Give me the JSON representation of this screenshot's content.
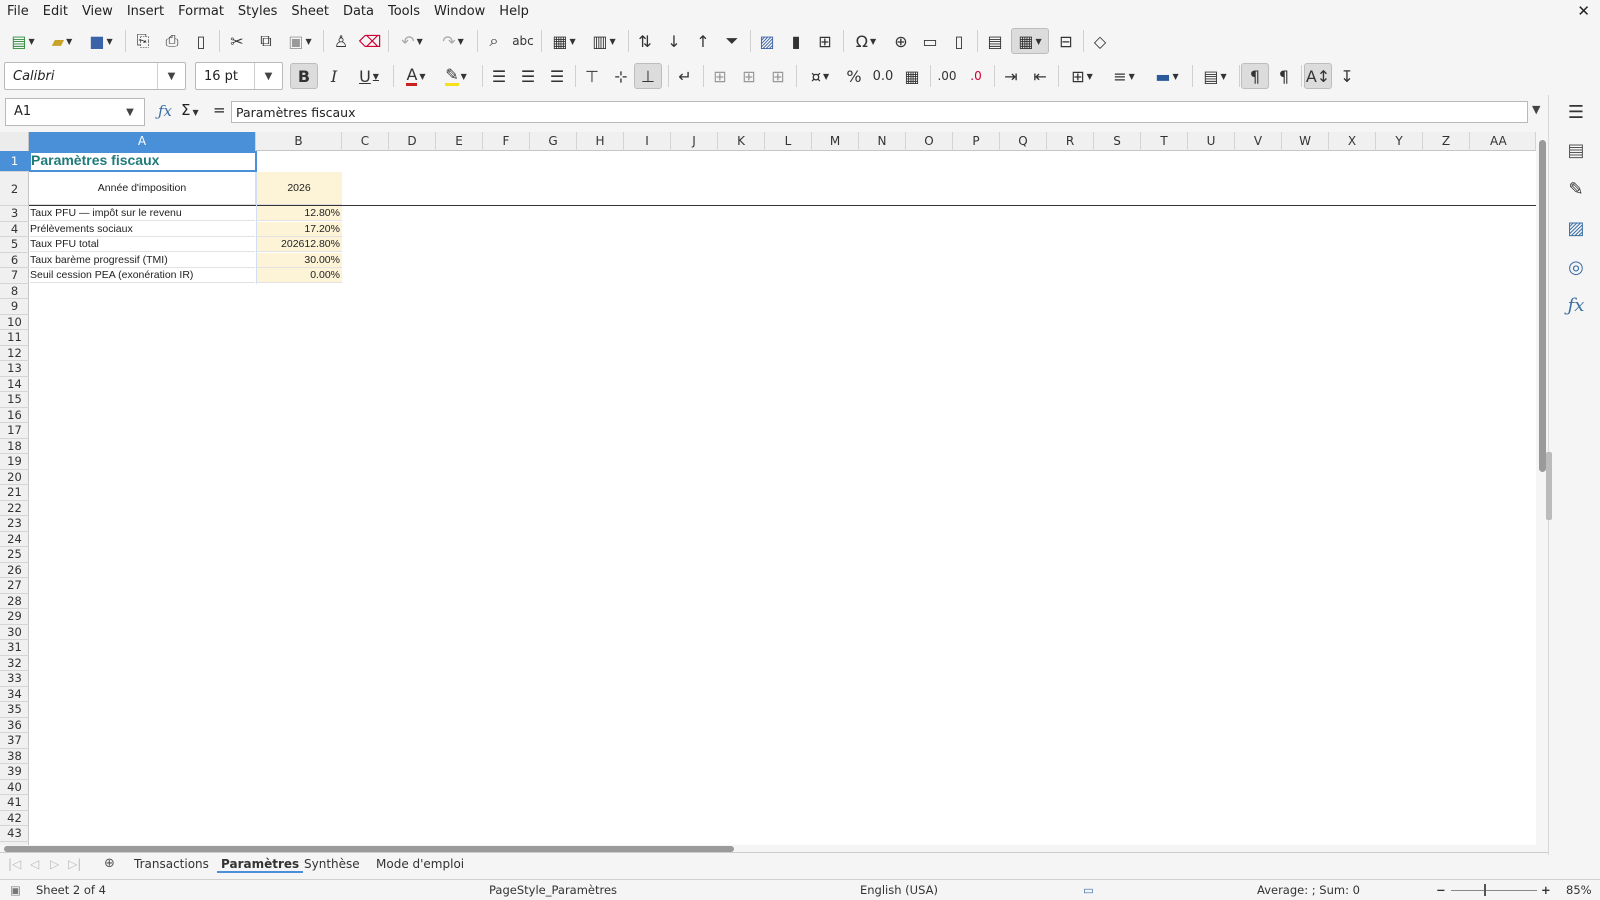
{
  "menu": {
    "items": [
      "File",
      "Edit",
      "View",
      "Insert",
      "Format",
      "Styles",
      "Sheet",
      "Data",
      "Tools",
      "Window",
      "Help"
    ]
  },
  "toolbar2": {
    "font_name": "Calibri",
    "font_size": "16 pt"
  },
  "formula_bar": {
    "name_box": "A1",
    "content": "Paramètres fiscaux"
  },
  "columns": [
    "A",
    "B",
    "C",
    "D",
    "E",
    "F",
    "G",
    "H",
    "I",
    "J",
    "K",
    "L",
    "M",
    "N",
    "O",
    "P",
    "Q",
    "R",
    "S",
    "T",
    "U",
    "V",
    "W",
    "X",
    "Y",
    "Z",
    "AA"
  ],
  "rows": [
    "1",
    "2",
    "3",
    "4",
    "5",
    "6",
    "7",
    "8",
    "9",
    "10",
    "11",
    "12",
    "13",
    "14",
    "15",
    "16",
    "17",
    "18",
    "19",
    "20",
    "21",
    "22",
    "23",
    "24",
    "25",
    "26",
    "27",
    "28",
    "29",
    "30",
    "31",
    "32",
    "33",
    "34",
    "35",
    "36",
    "37",
    "38",
    "39",
    "40",
    "41",
    "42",
    "43"
  ],
  "sheet": {
    "title": "Paramètres fiscaux",
    "year_label": "Année d'imposition",
    "year_value": "2026",
    "params": [
      {
        "label": "Taux PFU — impôt sur le revenu",
        "value": "12.80%"
      },
      {
        "label": "Prélèvements sociaux",
        "value": "17.20%"
      },
      {
        "label": "Taux PFU total",
        "value": "202612.80%"
      },
      {
        "label": "Taux barème progressif (TMI)",
        "value": "30.00%"
      },
      {
        "label": "Seuil cession PEA (exonération IR)",
        "value": "0.00%"
      }
    ],
    "title_color": "#1f7a7a",
    "value_fill": "#fdf3d6"
  },
  "tabs": {
    "items": [
      "Transactions",
      "Paramètres",
      "Synthèse",
      "Mode d'emploi"
    ],
    "active": "Paramètres"
  },
  "status": {
    "sheet": "Sheet 2 of 4",
    "page_style": "PageStyle_Paramètres",
    "language": "English (USA)",
    "summary": "Average: ; Sum: 0",
    "zoom": "85%"
  }
}
